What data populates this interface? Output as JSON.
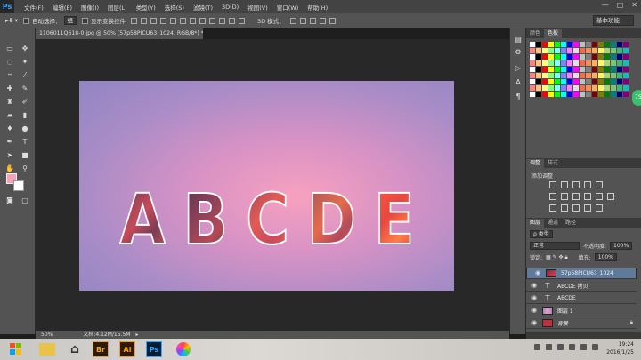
{
  "app": {
    "logo": "Ps"
  },
  "menu": [
    "文件(F)",
    "编辑(E)",
    "图像(I)",
    "图层(L)",
    "类型(Y)",
    "选择(S)",
    "滤镜(T)",
    "3D(D)",
    "视图(V)",
    "窗口(W)",
    "帮助(H)"
  ],
  "window_controls": {
    "minimize": "—",
    "maximize": "□",
    "close": "✕"
  },
  "options": {
    "auto_select_label": "自动选择：",
    "auto_select_value": "组",
    "show_transform_label": "显示变换控件",
    "mode_3d_label": "3D 模式：",
    "workspace": "基本功能"
  },
  "document": {
    "tab_title": "1106011Q618-0.jpg @ 50% (57p58PICU63_1024, RGB/8*) *",
    "canvas_text": [
      "A",
      "B",
      "C",
      "D",
      "E"
    ],
    "zoom": "50%",
    "doc_size": "文档:4.12M/15.5M"
  },
  "panels": {
    "color_tab": "颜色",
    "swatches_tab": "色板",
    "adjustments_tab": "调整",
    "styles_tab": "样式",
    "adjust_label": "添加调整",
    "layers_tab": "图层",
    "channels_tab": "通道",
    "paths_tab": "路径",
    "kind_label": "ρ 类型",
    "blend_mode": "正常",
    "opacity_label": "不透明度:",
    "opacity_value": "100%",
    "lock_label": "锁定:",
    "fill_label": "填充:",
    "fill_value": "100%"
  },
  "layers": [
    {
      "name": "57p58PICU63_1024",
      "type": "image",
      "selected": true
    },
    {
      "name": "ABCDE 拷贝",
      "type": "text",
      "selected": false
    },
    {
      "name": "ABCDE",
      "type": "text",
      "selected": false
    },
    {
      "name": "图层 1",
      "type": "image",
      "selected": false
    },
    {
      "name": "背景",
      "type": "image",
      "selected": false
    }
  ],
  "swatch_colors": [
    "#ffffff",
    "#000000",
    "#ff0000",
    "#ffff00",
    "#00ff00",
    "#00ffff",
    "#0000ff",
    "#ff00ff",
    "#c0c0c0",
    "#808080",
    "#800000",
    "#808000",
    "#008000",
    "#008080",
    "#000080",
    "#800080",
    "#ff8080",
    "#ffc080",
    "#ffff80",
    "#80ff80",
    "#80ffff",
    "#8080ff",
    "#ff80ff",
    "#e0e0e0",
    "#f26c4f",
    "#f68e55",
    "#fbaf5c",
    "#fff467",
    "#acd372",
    "#7cc576",
    "#3bb878",
    "#1abbb4"
  ],
  "green_badge": "75",
  "taskbar": {
    "time": "19:24",
    "date": "2016/1/25",
    "apps": [
      "Br",
      "Ai",
      "Ps"
    ]
  }
}
